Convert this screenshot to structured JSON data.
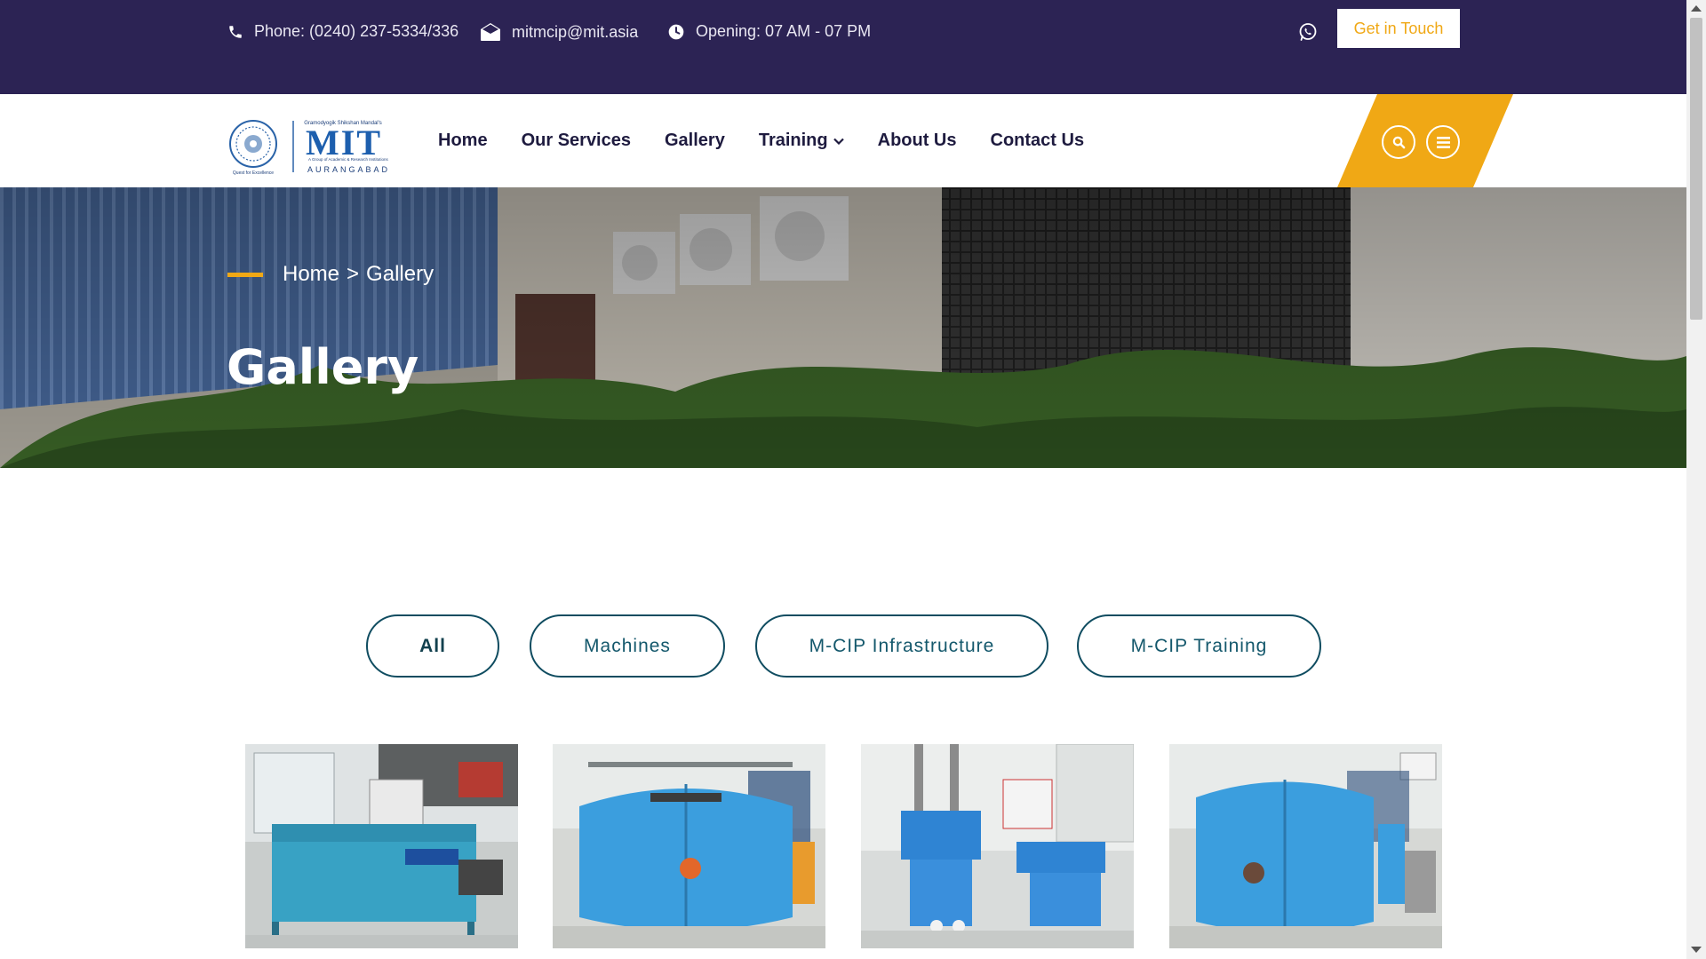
{
  "topbar": {
    "phone": "Phone: (0240) 237-5334/336",
    "email": "mitmcip@mit.asia",
    "hours": "Opening: 07 AM - 07 PM",
    "cta_label": "Get in Touch",
    "icons": [
      "phone-icon",
      "envelope-icon",
      "clock-icon",
      "whatsapp-icon"
    ]
  },
  "logo": {
    "org_line": "Gramodyogik Shikshan Mandal's",
    "name": "MIT",
    "tag": "A Group of Academic & Research Institutions",
    "city": "AURANGABAD",
    "motto": "Quest for Excellence"
  },
  "nav": {
    "items": [
      {
        "label": "Home"
      },
      {
        "label": "Our Services"
      },
      {
        "label": "Gallery"
      },
      {
        "label": "Training",
        "has_dropdown": true
      },
      {
        "label": "About Us"
      },
      {
        "label": "Contact Us"
      }
    ]
  },
  "hero": {
    "breadcrumb_home": "Home",
    "breadcrumb_sep": ">",
    "breadcrumb_current": "Gallery",
    "title": "Gallery"
  },
  "filters": [
    {
      "label": "All",
      "active": true
    },
    {
      "label": "Machines",
      "active": false
    },
    {
      "label": "M-CIP Infrastructure",
      "active": false
    },
    {
      "label": "M-CIP Training",
      "active": false
    }
  ],
  "gallery": {
    "items": [
      {
        "name": "machine-photo-1"
      },
      {
        "name": "machine-photo-2"
      },
      {
        "name": "machine-photo-3"
      },
      {
        "name": "machine-photo-4"
      }
    ]
  },
  "colors": {
    "topbar_bg": "#2c2354",
    "accent_yellow": "#f0a815",
    "filter_border": "#0f4c60",
    "nav_text": "#1e1b3f"
  }
}
